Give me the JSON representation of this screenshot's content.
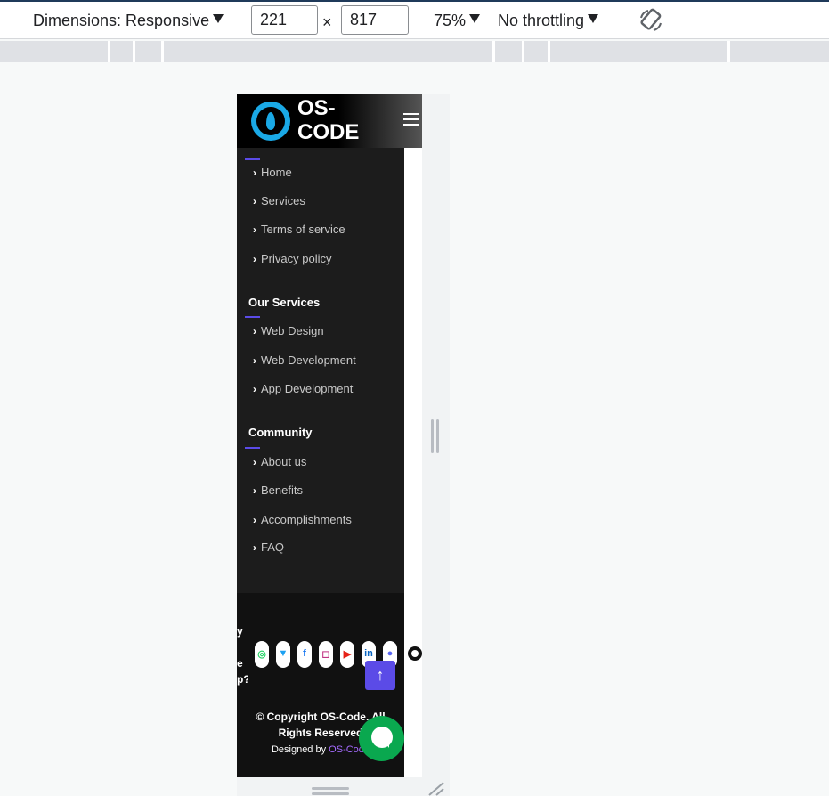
{
  "toolbar": {
    "dimensions_label": "Dimensions: Responsive",
    "width_value": "221",
    "height_value": "817",
    "times": "×",
    "zoom": "75%",
    "throttling": "No throttling"
  },
  "site": {
    "brand": "OS-CODE",
    "menu_icon": "hamburger-icon",
    "quick_links": [
      {
        "label": "Home"
      },
      {
        "label": "Services"
      },
      {
        "label": "Terms of service"
      },
      {
        "label": "Privacy policy"
      }
    ],
    "services_title": "Our Services",
    "services": [
      {
        "label": "Web Design"
      },
      {
        "label": "Web Development"
      },
      {
        "label": "App Development"
      }
    ],
    "community_title": "Community",
    "community": [
      {
        "label": "About us"
      },
      {
        "label": "Benefits"
      },
      {
        "label": "Accomplishments"
      },
      {
        "label": "FAQ"
      }
    ],
    "cut_text": "y\n\ne\np?",
    "social_icons": [
      "whatsapp-icon",
      "twitter-icon",
      "facebook-icon",
      "instagram-icon",
      "youtube-icon",
      "linkedin-icon",
      "discord-icon",
      "github-icon"
    ],
    "back_to_top": "↑",
    "copyright": "© Copyright OS-Code. All Rights Reserved",
    "designed_by_prefix": "Designed by ",
    "designed_by_name": "OS-Code"
  },
  "colors": {
    "accent": "#5b4be7",
    "chat": "#0aa84f",
    "logo": "#1aa9e6"
  }
}
